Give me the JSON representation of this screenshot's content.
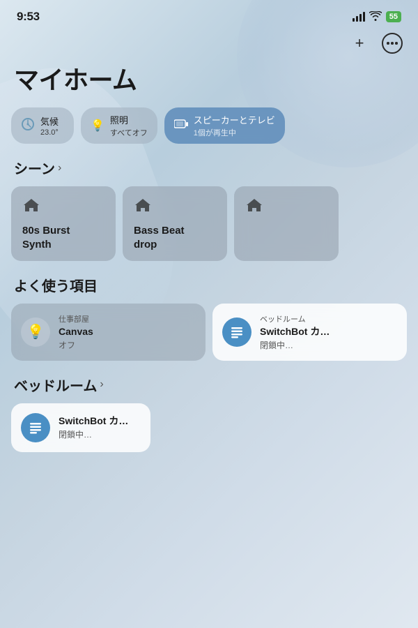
{
  "statusBar": {
    "time": "9:53",
    "battery": "55",
    "batteryColor": "#4CAF50"
  },
  "pageTitle": "マイホーム",
  "actions": {
    "add": "+",
    "more": "···"
  },
  "categories": [
    {
      "icon": "❄️",
      "label": "気候",
      "sub": "23.0°",
      "active": false
    },
    {
      "icon": "💡",
      "label": "照明",
      "sub": "すべてオフ",
      "active": false
    },
    {
      "icon": "📺",
      "label": "スピーカーとテレビ",
      "sub": "1個が再生中",
      "active": true
    }
  ],
  "scenes": {
    "sectionLabel": "シーン",
    "items": [
      {
        "name": "80s Burst\nSynth"
      },
      {
        "name": "Bass Beat\ndrop"
      },
      {
        "name": ""
      }
    ]
  },
  "favorites": {
    "sectionLabel": "よく使う項目",
    "items": [
      {
        "location": "仕事部屋",
        "name": "Canvas",
        "status": "オフ",
        "iconType": "bulb",
        "whiteBg": false
      },
      {
        "location": "ベッドルーム",
        "name": "SwitchBot カ…",
        "status": "閉鎖中…",
        "iconType": "switchbot",
        "whiteBg": true
      }
    ]
  },
  "bedroom": {
    "sectionLabel": "ベッドルーム",
    "device": {
      "location": "",
      "name": "SwitchBot カ…",
      "status": "閉鎖中…",
      "iconType": "switchbot"
    }
  }
}
